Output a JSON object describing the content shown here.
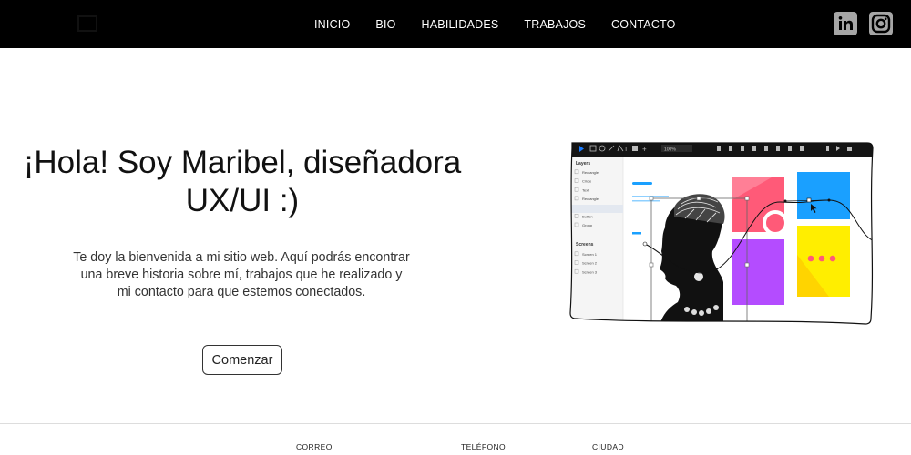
{
  "header": {
    "nav": [
      {
        "label": "INICIO"
      },
      {
        "label": "BIO"
      },
      {
        "label": "HABILIDADES"
      },
      {
        "label": "TRABAJOS"
      },
      {
        "label": "CONTACTO"
      }
    ],
    "social": [
      {
        "icon": "linkedin-icon"
      },
      {
        "icon": "instagram-icon"
      }
    ],
    "logo_icon": "logo-icon"
  },
  "hero": {
    "title": "¡Hola! Soy Maribel, diseñadora UX/UI :)",
    "text": "Te doy la bienvenida a mi sitio web. Aquí podrás encontrar una breve historia sobre mí, trabajos que he realizado y mi contacto para que estemos conectados.",
    "cta": "Comenzar"
  },
  "illustration": {
    "zoom": "100%",
    "layers_title": "Layers",
    "layers": [
      "Rectangle",
      "Circle",
      "Text",
      "Rectangle",
      "Image",
      "Button",
      "Group"
    ],
    "screens_title": "Screens",
    "screens": [
      "Screen 1",
      "Screen 2",
      "Screen 3"
    ]
  },
  "footer": {
    "columns": [
      {
        "label": "CORREO",
        "value": ""
      },
      {
        "label": "TELÉFONO",
        "value": ""
      },
      {
        "label": "CIUDAD",
        "value": ""
      }
    ]
  },
  "colors": {
    "header_bg": "#000000",
    "pink": "#ff5a78",
    "blue": "#1aa0ff",
    "purple": "#b44cff",
    "yellow": "#ffee00",
    "selection": "#1a7cff"
  }
}
